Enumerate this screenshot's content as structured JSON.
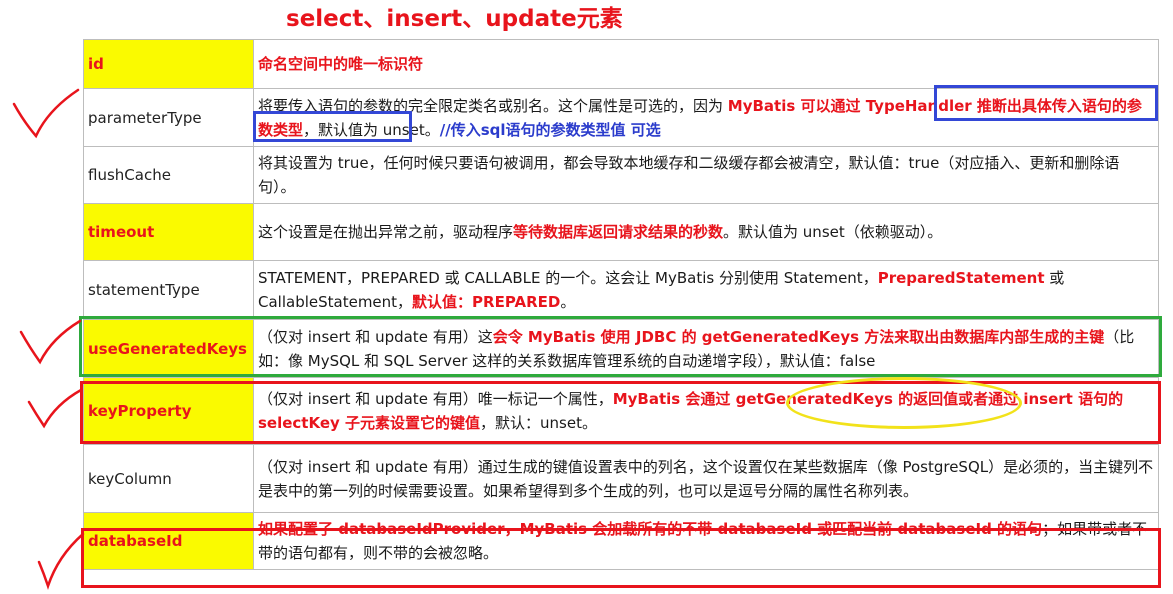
{
  "title": "select、insert、update元素",
  "rows": [
    {
      "name": "id",
      "desc": [
        {
          "t": "命名空间中的唯一标识符",
          "s": "r"
        }
      ]
    },
    {
      "name": "parameterType",
      "desc": [
        {
          "t": "将要传入语句的参数的完全限定类名或别名。这个属性是可选的，因为 ",
          "s": ""
        },
        {
          "t": "MyBatis 可以通过 TypeHandler 推断出具体传入语句的参数类型",
          "s": "r"
        },
        {
          "t": "，默认值为 unset。",
          "s": ""
        },
        {
          "t": "//传入sql语句的参数类型值  可选",
          "s": "b"
        }
      ]
    },
    {
      "name": "flushCache",
      "desc": [
        {
          "t": "将其设置为 true，任何时候只要语句被调用，都会导致本地缓存和二级缓存都会被清空，默认值：true（对应插入、更新和删除语句）。",
          "s": ""
        }
      ]
    },
    {
      "name": "timeout",
      "desc": [
        {
          "t": "这个设置是在抛出异常之前，驱动程序",
          "s": ""
        },
        {
          "t": "等待数据库返回请求结果的秒数",
          "s": "r"
        },
        {
          "t": "。默认值为 unset（依赖驱动）。",
          "s": ""
        }
      ]
    },
    {
      "name": "statementType",
      "desc": [
        {
          "t": "STATEMENT，PREPARED 或 CALLABLE 的一个。这会让 MyBatis 分别使用 Statement，",
          "s": ""
        },
        {
          "t": "PreparedStatement",
          "s": "r"
        },
        {
          "t": " 或 CallableStatement，",
          "s": ""
        },
        {
          "t": "默认值：PREPARED",
          "s": "r"
        },
        {
          "t": "。",
          "s": ""
        }
      ]
    },
    {
      "name": "useGeneratedKeys",
      "desc": [
        {
          "t": "（仅对 insert 和 update 有用）这",
          "s": ""
        },
        {
          "t": "会令 MyBatis 使用 JDBC 的 getGeneratedKeys 方法来取出由数据库内部生成的主键",
          "s": "r"
        },
        {
          "t": "（比如：像 MySQL 和 SQL Server 这样的关系数据库管理系统的自动递增字段），默认值：false",
          "s": ""
        }
      ]
    },
    {
      "name": "keyProperty",
      "desc": [
        {
          "t": "（仅对 insert 和 update 有用）唯一标记一个属性，",
          "s": ""
        },
        {
          "t": "MyBatis 会通过 getGeneratedKeys 的返回值或者通过 insert 语句的 selectKey 子元素设置它的键值",
          "s": "r"
        },
        {
          "t": "，默认：unset。",
          "s": ""
        }
      ]
    },
    {
      "name": "keyColumn",
      "desc": [
        {
          "t": "（仅对 insert 和 update 有用）通过生成的键值设置表中的列名，这个设置仅在某些数据库（像 PostgreSQL）是必须的，当主键列不是表中的第一列的时候需要设置。如果希望得到多个生成的列，也可以是逗号分隔的属性名称列表。",
          "s": ""
        }
      ]
    },
    {
      "name": "databaseId",
      "desc": [
        {
          "t": "如果配置了 databaseIdProvider，MyBatis 会加载所有的不带 databaseId 或匹配当前 databaseId 的语句",
          "s": "r"
        },
        {
          "t": "；如果带或者不带的语句都有，则不带的会被忽略。",
          "s": ""
        }
      ]
    }
  ],
  "highlighted_rows": [
    0,
    3,
    5,
    6,
    8
  ]
}
